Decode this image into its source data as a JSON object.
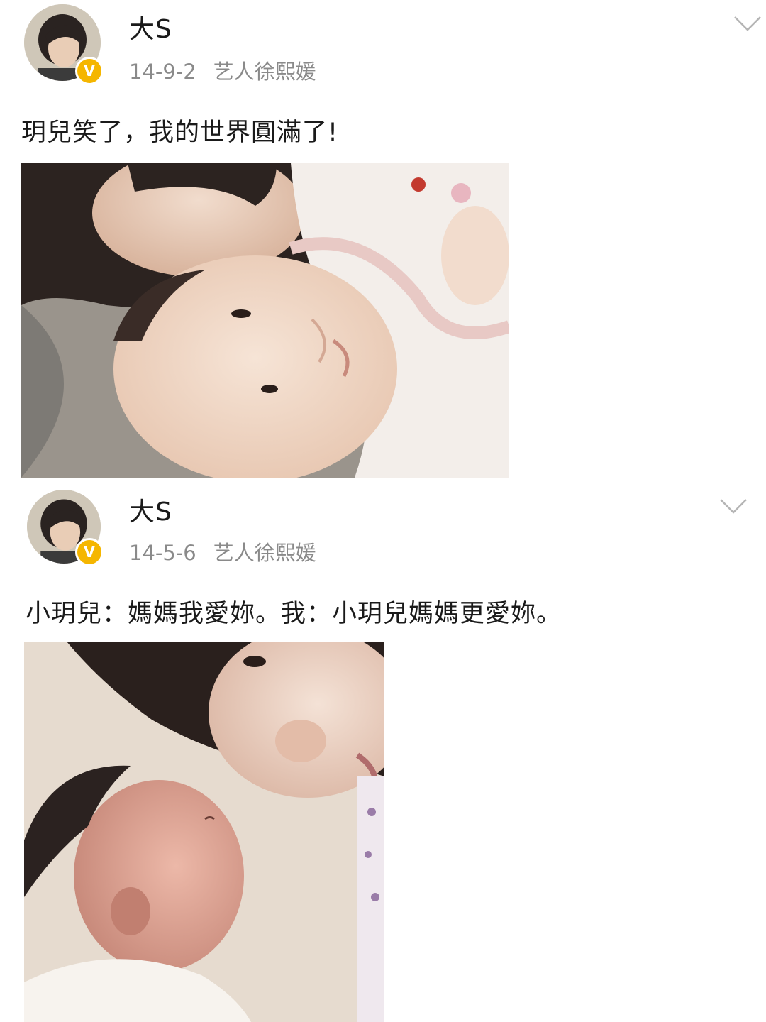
{
  "posts": [
    {
      "author": "大S",
      "date": "14-9-2",
      "source": "艺人徐熙媛",
      "verified_badge": "V",
      "text": "玥兒笑了，我的世界圓滿了!",
      "photo": "photo-mother-and-smiling-baby",
      "menu_icon": "chevron-down-icon"
    },
    {
      "author": "大S",
      "date": "14-5-6",
      "source": "艺人徐熙媛",
      "verified_badge": "V",
      "text": "小玥兒：媽媽我愛妳。我：小玥兒媽媽更愛妳。",
      "photo": "photo-mother-and-newborn",
      "menu_icon": "chevron-down-icon"
    }
  ],
  "colors": {
    "verified_badge": "#f5b600",
    "meta_text": "#8a8a8a",
    "body_text": "#1a1a1a"
  }
}
